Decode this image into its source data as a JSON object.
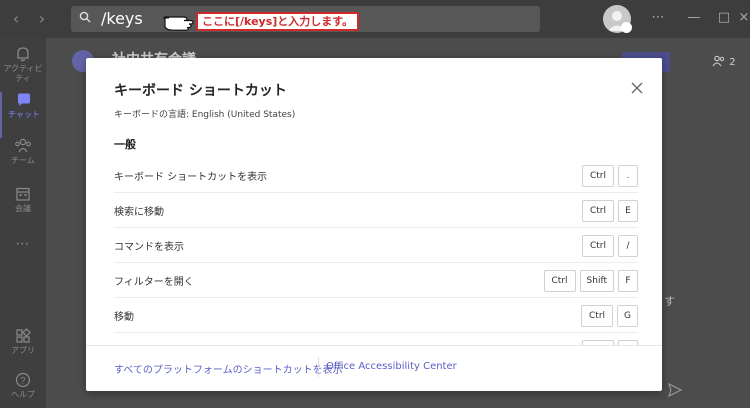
{
  "search": {
    "value": "/keys"
  },
  "callout": {
    "text": "ここに[/keys]と入力します。"
  },
  "rail": {
    "items": [
      {
        "label": "アクティビティ"
      },
      {
        "label": "チャット"
      },
      {
        "label": "チーム"
      },
      {
        "label": "会議"
      },
      {
        "label": "アプリ"
      },
      {
        "label": "ヘルプ"
      }
    ],
    "more": "⋯"
  },
  "background": {
    "header_title": "社内共有会議",
    "people_count": "2",
    "side_text": "す"
  },
  "modal": {
    "title": "キーボード ショートカット",
    "subtitle": "キーボードの言語: English (United States)",
    "section_title": "一般",
    "shortcuts": [
      {
        "label": "キーボード ショートカットを表示",
        "keys": [
          "Ctrl",
          "."
        ]
      },
      {
        "label": "検索に移動",
        "keys": [
          "Ctrl",
          "E"
        ]
      },
      {
        "label": "コマンドを表示",
        "keys": [
          "Ctrl",
          "/"
        ]
      },
      {
        "label": "フィルターを開く",
        "keys": [
          "Ctrl",
          "Shift",
          "F"
        ]
      },
      {
        "label": "移動",
        "keys": [
          "Ctrl",
          "G"
        ]
      },
      {
        "label": "",
        "keys": [
          "",
          ""
        ]
      }
    ],
    "footer_links": [
      {
        "label": "すべてのプラットフォームのショートカットを表示"
      },
      {
        "label": "Office Accessibility Center"
      }
    ]
  },
  "colors": {
    "accent": "#6264a7",
    "link": "#5b5fc7",
    "callout_red": "#d1282a",
    "topbar": "#3d3d3d"
  }
}
